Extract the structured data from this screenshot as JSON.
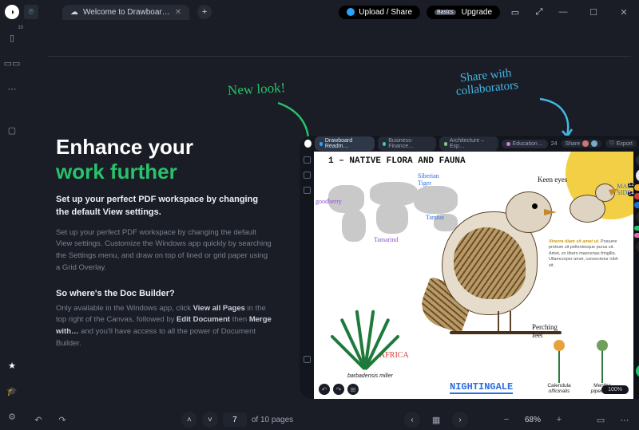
{
  "titlebar": {
    "tab_label": "Welcome to Drawboar…",
    "upload_share": "Upload / Share",
    "upgrade_badge": "Basics",
    "upgrade_label": "Upgrade"
  },
  "annotations": {
    "new_look": "New look!",
    "share_collab": "Share with\ncollaborators"
  },
  "copy": {
    "headline_a": "Enhance your",
    "headline_b": "work further",
    "lead": "Set up your perfect PDF workspace by changing the default View settings.",
    "body": "Set up your perfect PDF workspace by changing the default View settings. Customize the Windows app quickly by searching the Settings menu, and draw on top of lined or grid paper using a Grid Overlay.",
    "subhead": "So where's the Doc Builder?",
    "body2_pre": "Only available in the Windows app, click ",
    "body2_b1": "View all Pages",
    "body2_mid": " in the top right of the Canvas, followed by ",
    "body2_b2": "Edit Document",
    "body2_mid2": " then ",
    "body2_b3": "Merge with…",
    "body2_post": " and you'll have access to all the power of Document Builder."
  },
  "device": {
    "tabs": [
      "Drawboard Readm…",
      "Business-Finance…",
      "Architecture – Exp…",
      "Education…"
    ],
    "page_count": "24",
    "share": "Share",
    "export": "Export",
    "canvas": {
      "title": "1 – NATIVE FLORA AND FAUNA",
      "map_labels": {
        "goodberry": "goodberry",
        "siberian_tiger": "Siberian\nTiger",
        "tarsius": "Tarsius",
        "tamarind": "Tamarind",
        "africa": "AFRICA"
      },
      "plant_latin": "barbadensis miller",
      "bird": {
        "keen_eyes": "Keen eyes",
        "perching_feet": "Perching\nfeet",
        "name": "NIGHTINGALE",
        "male_side": "MALE\nSIDE"
      },
      "paragraph_lead": "Viverra diam sit amet ut.",
      "paragraph_body": " Posuere pretium sit pellentesque purus sit. Amet, ex libero maecenas fringilla. Ullamcorper amet, consectetur nibh sit.",
      "botanicals": [
        {
          "common": "Calendula",
          "latin": "officinalis"
        },
        {
          "common": "Mentha",
          "latin": "piperita L."
        }
      ],
      "zoom": "100%"
    },
    "pen_badges": {
      "p1": "12",
      "p2": "14"
    }
  },
  "bottombar": {
    "current_page": "7",
    "of_pages": "of 10 pages",
    "zoom": "68%"
  }
}
